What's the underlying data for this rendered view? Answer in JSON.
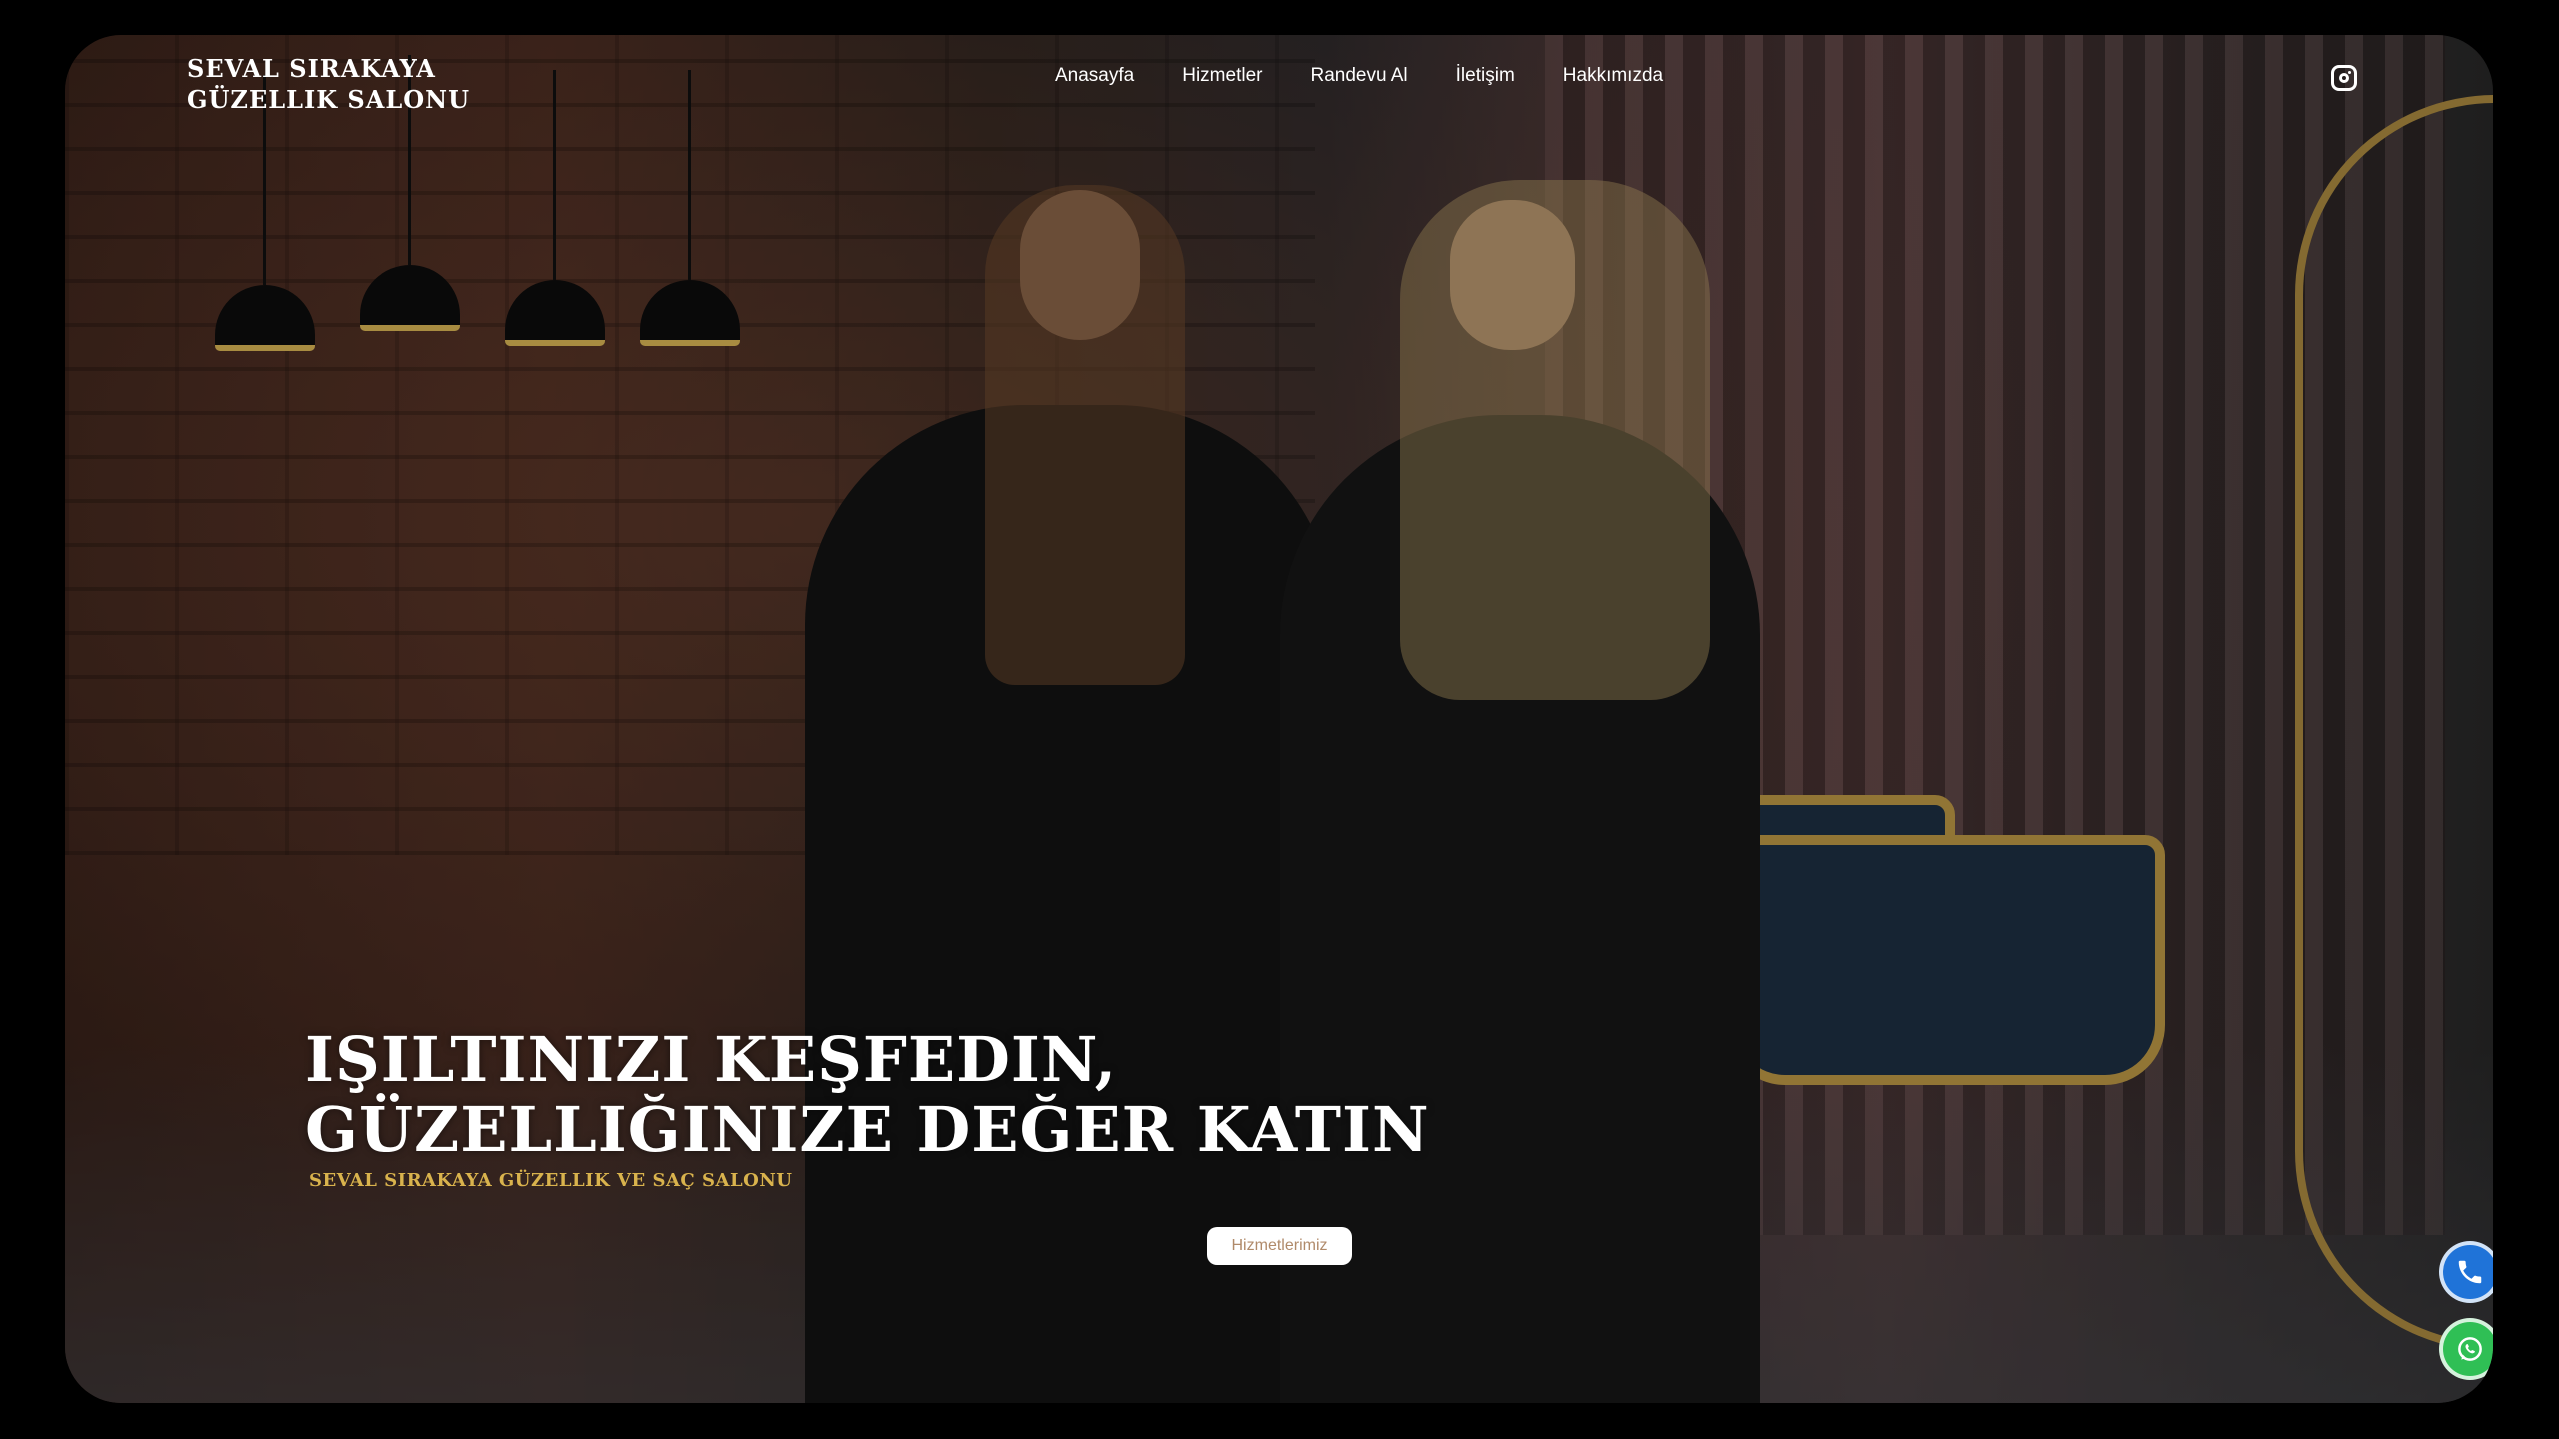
{
  "header": {
    "logo_line1": "SEVAL SIRAKAYA",
    "logo_line2": "GÜZELLIK SALONU",
    "nav": [
      {
        "label": "Anasayfa"
      },
      {
        "label": "Hizmetler"
      },
      {
        "label": "Randevu Al"
      },
      {
        "label": "İletişim"
      },
      {
        "label": "Hakkımızda"
      }
    ],
    "social_icon": "instagram-icon"
  },
  "hero": {
    "title_line1": "IŞILTINIZI KEŞFEDIN,",
    "title_line2": "GÜZELLIĞINIZE DEĞER KATIN",
    "subtitle": "SEVAL SIRAKAYA GÜZELLIK VE SAÇ SALONU",
    "cta_label": "Hizmetlerimiz"
  },
  "floating": {
    "phone_icon": "phone-icon",
    "whatsapp_icon": "whatsapp-icon"
  },
  "colors": {
    "accent_gold": "#d9b34d",
    "phone_blue": "#1f73d8",
    "whatsapp_green": "#2fbf55"
  }
}
